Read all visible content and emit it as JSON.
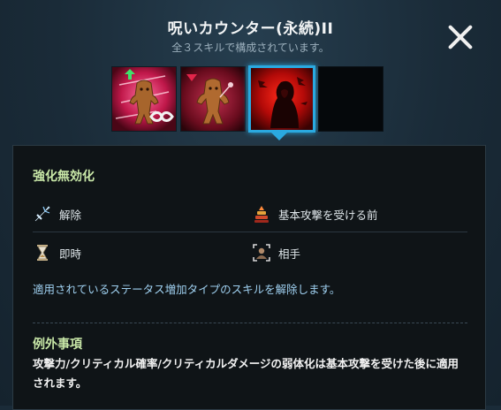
{
  "header": {
    "title": "呪いカウンター(永続)II",
    "subtitle": "全３スキルで構成されています。"
  },
  "skills": [
    {
      "icon": "wooden-doll-infinity-icon"
    },
    {
      "icon": "wooden-doll-icon"
    },
    {
      "icon": "hooded-figure-icon",
      "selected": true
    },
    {
      "icon": "empty-slot"
    }
  ],
  "panel": {
    "title": "強化無効化",
    "attrs": [
      {
        "icon": "sword-icon",
        "label": "解除"
      },
      {
        "icon": "stack-icon",
        "label": "基本攻撃を受ける前"
      },
      {
        "icon": "hourglass-icon",
        "label": "即時"
      },
      {
        "icon": "target-icon",
        "label": "相手"
      }
    ],
    "description": "適用されているステータス増加タイプのスキルを解除します。",
    "exception_title": "例外事項",
    "exception_text": "攻撃力/クリティカル確率/クリティカルダメージの弱体化は基本攻撃を受けた後に適用されます。"
  },
  "colors": {
    "accent": "#2aa9e0",
    "heading": "#c9e8a8",
    "description": "#9fd0f0"
  }
}
